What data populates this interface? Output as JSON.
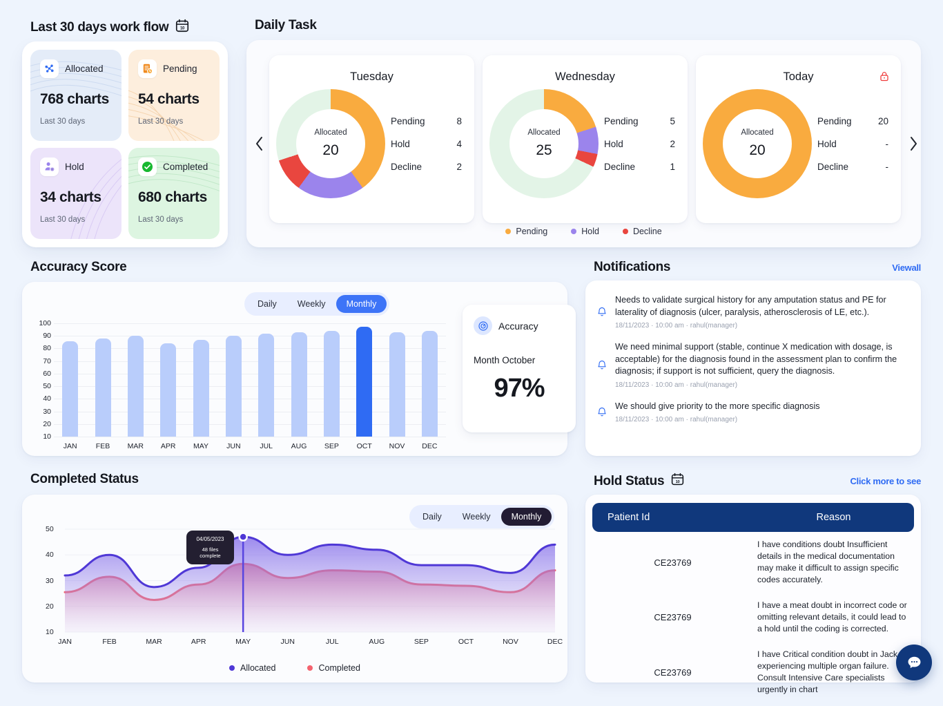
{
  "workflow": {
    "title": "Last 30 days work flow",
    "calendar_icon": "calendar-icon",
    "cards": [
      {
        "label": "Allocated",
        "value": "768 charts",
        "sub": "Last 30 days",
        "icon": "network-nodes-icon",
        "color": "#e4ecf8"
      },
      {
        "label": "Pending",
        "value": "54 charts",
        "sub": "Last 30 days",
        "icon": "document-clock-icon",
        "color": "#fdeedd"
      },
      {
        "label": "Hold",
        "value": "34 charts",
        "sub": "Last 30 days",
        "icon": "user-pause-icon",
        "color": "#ece4fa"
      },
      {
        "label": "Completed",
        "value": "680 charts",
        "sub": "Last 30 days",
        "icon": "check-circle-icon",
        "color": "#ddf5e1"
      }
    ]
  },
  "daily_task": {
    "title": "Daily Task",
    "prev_label": "‹",
    "next_label": "›",
    "center_label": "Allocated",
    "rows": [
      "Pending",
      "Hold",
      "Decline"
    ],
    "days": [
      {
        "name": "Tuesday",
        "allocated": "20",
        "pending": "8",
        "hold": "4",
        "decline": "2",
        "locked": false
      },
      {
        "name": "Wednesday",
        "allocated": "25",
        "pending": "5",
        "hold": "2",
        "decline": "1",
        "locked": false
      },
      {
        "name": "Today",
        "allocated": "20",
        "pending": "20",
        "hold": "-",
        "decline": "-",
        "locked": true
      }
    ],
    "legend": [
      {
        "label": "Pending",
        "color": "#f9ab3f"
      },
      {
        "label": "Hold",
        "color": "#9b84ec"
      },
      {
        "label": "Decline",
        "color": "#e9463f"
      }
    ]
  },
  "accuracy": {
    "title": "Accuracy Score",
    "tabs": [
      "Daily",
      "Weekly",
      "Monthly"
    ],
    "active_tab": "Monthly",
    "card": {
      "icon": "gauge-icon",
      "title": "Accuracy",
      "month_label": "Month October",
      "percent": "97%"
    }
  },
  "notifications": {
    "title": "Notifications",
    "viewall": "Viewall",
    "items": [
      {
        "text": "Needs to validate surgical history for any amputation status and PE for laterality of diagnosis (ulcer, paralysis, atherosclerosis of LE, etc.).",
        "meta": "18/11/2023 · 10:00 am  · rahul(manager)"
      },
      {
        "text": "We need minimal support (stable, continue X medication with dosage, is acceptable) for the diagnosis found in the assessment plan to confirm the diagnosis; if support is not sufficient, query the diagnosis.",
        "meta": "18/11/2023 · 10:00 am  · rahul(manager)"
      },
      {
        "text": "We should give priority to the more specific diagnosis",
        "meta": "18/11/2023 · 10:00 am  · rahul(manager)"
      }
    ]
  },
  "completed_status": {
    "title": "Completed Status",
    "tabs": [
      "Daily",
      "Weekly",
      "Monthly"
    ],
    "active_tab": "Monthly",
    "tooltip": {
      "date": "04/05/2023",
      "text": "48 files complete"
    },
    "legend": [
      {
        "label": "Allocated",
        "color": "#4f38d6"
      },
      {
        "label": "Completed",
        "color": "#f4636f"
      }
    ]
  },
  "hold_status": {
    "title": "Hold Status",
    "calendar_icon": "calendar-icon",
    "click_more": "Click more to see",
    "columns": [
      "Patient Id",
      "Reason"
    ],
    "rows": [
      {
        "patient_id": "CE23769",
        "reason": "I have conditions doubt Insufficient details in the medical documentation may make it difficult to assign specific codes accurately."
      },
      {
        "patient_id": "CE23769",
        "reason": " I have a meat doubt in incorrect code or omitting relevant details, it could lead to a hold until the coding is corrected."
      },
      {
        "patient_id": "CE23769",
        "reason": "I have Critical condition doubt in Jack experiencing multiple organ failure. Consult Intensive Care specialists urgently in chart"
      }
    ]
  },
  "chat_button": {
    "icon": "chat-bubble-icon"
  },
  "chart_data": [
    {
      "type": "bar",
      "title": "Accuracy Score",
      "categories": [
        "JAN",
        "FEB",
        "MAR",
        "APR",
        "MAY",
        "JUN",
        "JUL",
        "AUG",
        "SEP",
        "OCT",
        "NOV",
        "DEC"
      ],
      "values": [
        86,
        88,
        90,
        84,
        87,
        90,
        92,
        93,
        94,
        97,
        93,
        94
      ],
      "highlight_index": 9,
      "ylabel": "",
      "xlabel": "",
      "ylim": [
        10,
        100
      ],
      "yticks": [
        100,
        90,
        80,
        70,
        60,
        50,
        40,
        30,
        20,
        10
      ],
      "grid": true,
      "bar_color": "#b9cdfb",
      "highlight_color": "#2f6bf3"
    },
    {
      "type": "area",
      "title": "Completed Status",
      "x": [
        "JAN",
        "FEB",
        "MAR",
        "APR",
        "MAY",
        "JUN",
        "JUL",
        "AUG",
        "SEP",
        "OCT",
        "NOV",
        "DEC"
      ],
      "ylim": [
        10,
        50
      ],
      "yticks": [
        50,
        40,
        30,
        20,
        10
      ],
      "grid": true,
      "legend_position": "bottom",
      "series": [
        {
          "name": "Allocated",
          "color": "#4f38d6",
          "values": [
            32,
            40,
            27.5,
            35,
            47,
            40,
            44,
            42,
            36,
            36,
            33,
            44
          ]
        },
        {
          "name": "Completed",
          "color": "#f4636f",
          "values": [
            25.5,
            31.5,
            22.5,
            28.5,
            36.5,
            31,
            34,
            33.5,
            28.5,
            28,
            25.5,
            34
          ]
        }
      ]
    },
    {
      "type": "pie",
      "title": "Tuesday",
      "labels": [
        "Pending",
        "Hold",
        "Decline",
        "Remaining"
      ],
      "values": [
        8,
        4,
        2,
        6
      ],
      "colors": [
        "#f9ab3f",
        "#9b84ec",
        "#e9463f",
        "#e3f4e7"
      ]
    },
    {
      "type": "pie",
      "title": "Wednesday",
      "labels": [
        "Pending",
        "Hold",
        "Decline",
        "Remaining"
      ],
      "values": [
        5,
        2,
        1,
        17
      ],
      "colors": [
        "#f9ab3f",
        "#9b84ec",
        "#e9463f",
        "#e3f4e7"
      ]
    },
    {
      "type": "pie",
      "title": "Today",
      "labels": [
        "Pending",
        "Hold",
        "Decline",
        "Remaining"
      ],
      "values": [
        20,
        0,
        0,
        0
      ],
      "colors": [
        "#f9ab3f",
        "#9b84ec",
        "#e9463f",
        "#e3f4e7"
      ]
    }
  ]
}
